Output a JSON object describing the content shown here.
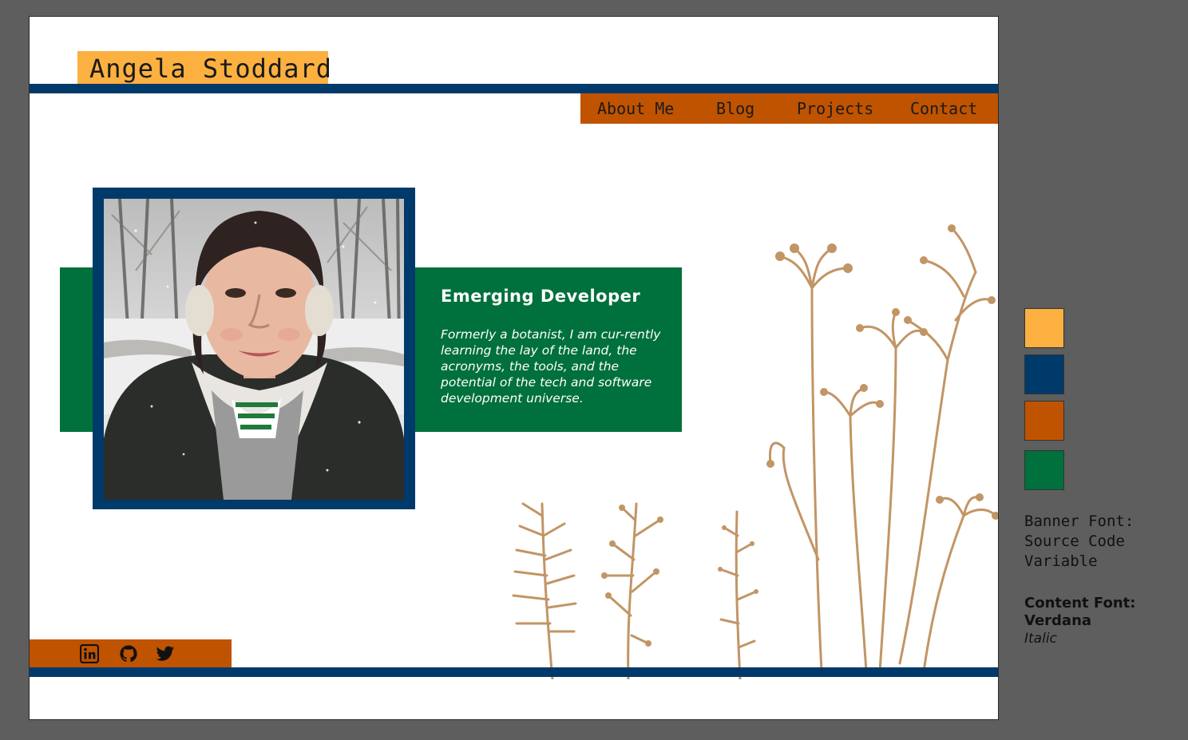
{
  "banner": {
    "name": "Angela Stoddard"
  },
  "nav": [
    "About Me",
    "Blog",
    "Projects",
    "Contact"
  ],
  "hero": {
    "title": "Emerging Developer",
    "body": "Formerly a botanist, I am cur-rently learning the lay of the land, the acronyms, the tools, and the potential of the tech and software development universe."
  },
  "social": [
    "linkedin-icon",
    "github-icon",
    "twitter-icon"
  ],
  "palette": [
    "#fbb040",
    "#003a6b",
    "#c05300",
    "#00703c"
  ],
  "legend": {
    "banner_font": "Banner Font: Source Code Variable",
    "content_font_label": "Content Font:",
    "content_font_name": "Verdana",
    "content_font_style": "Italic"
  }
}
